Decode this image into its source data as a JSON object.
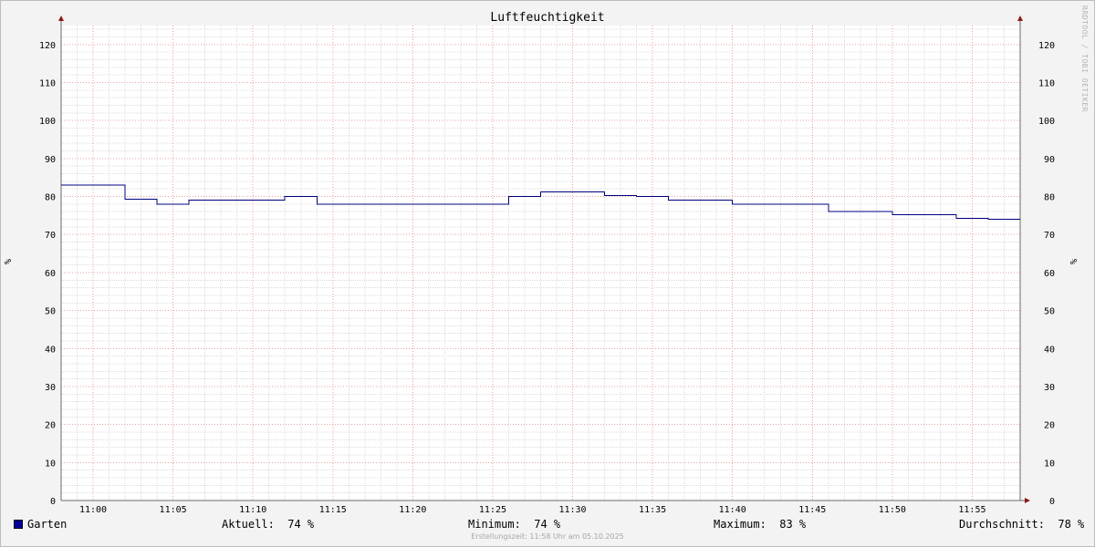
{
  "chart_data": {
    "type": "line",
    "title": "Luftfeuchtigkeit",
    "ylabel": "%",
    "ylabel_right": "%",
    "ylim": [
      0,
      125
    ],
    "yticks": [
      0,
      10,
      20,
      30,
      40,
      50,
      60,
      70,
      80,
      90,
      100,
      110,
      120
    ],
    "xlim": [
      "10:58",
      "11:58"
    ],
    "xticks": [
      "11:00",
      "11:05",
      "11:10",
      "11:15",
      "11:20",
      "11:25",
      "11:30",
      "11:35",
      "11:40",
      "11:45",
      "11:50",
      "11:55"
    ],
    "grid": true,
    "interpolation": "step",
    "series": [
      {
        "name": "Garten",
        "color": "#000080",
        "x": [
          "10:58",
          "11:02",
          "11:04",
          "11:06",
          "11:12",
          "11:14",
          "11:26",
          "11:28",
          "11:32",
          "11:34",
          "11:36",
          "11:40",
          "11:46",
          "11:50",
          "11:54",
          "11:56",
          "11:58"
        ],
        "values": [
          83,
          79.3,
          78,
          79,
          80,
          78,
          80,
          81.2,
          80.2,
          80,
          79,
          78,
          76,
          75.2,
          74.2,
          74,
          74
        ]
      }
    ]
  },
  "legend": {
    "series_name": "Garten",
    "swatch_color": "#00009c",
    "current": "Aktuell:  74 %",
    "minimum": "Minimum:  74 %",
    "maximum": "Maximum:  83 %",
    "average": "Durchschnitt:  78 %"
  },
  "footer": "Erstellungszeit: 11:58 Uhr am 05.10.2025",
  "watermark": "RRDTOOL / TOBI OETIKER",
  "colors": {
    "background": "#f3f3f3",
    "canvas": "#ffffff",
    "grid_minor": "#dcdcdc",
    "grid_major": "#e8a3a3",
    "axis": "#6b6b6b",
    "arrow": "#8b1a1a"
  }
}
